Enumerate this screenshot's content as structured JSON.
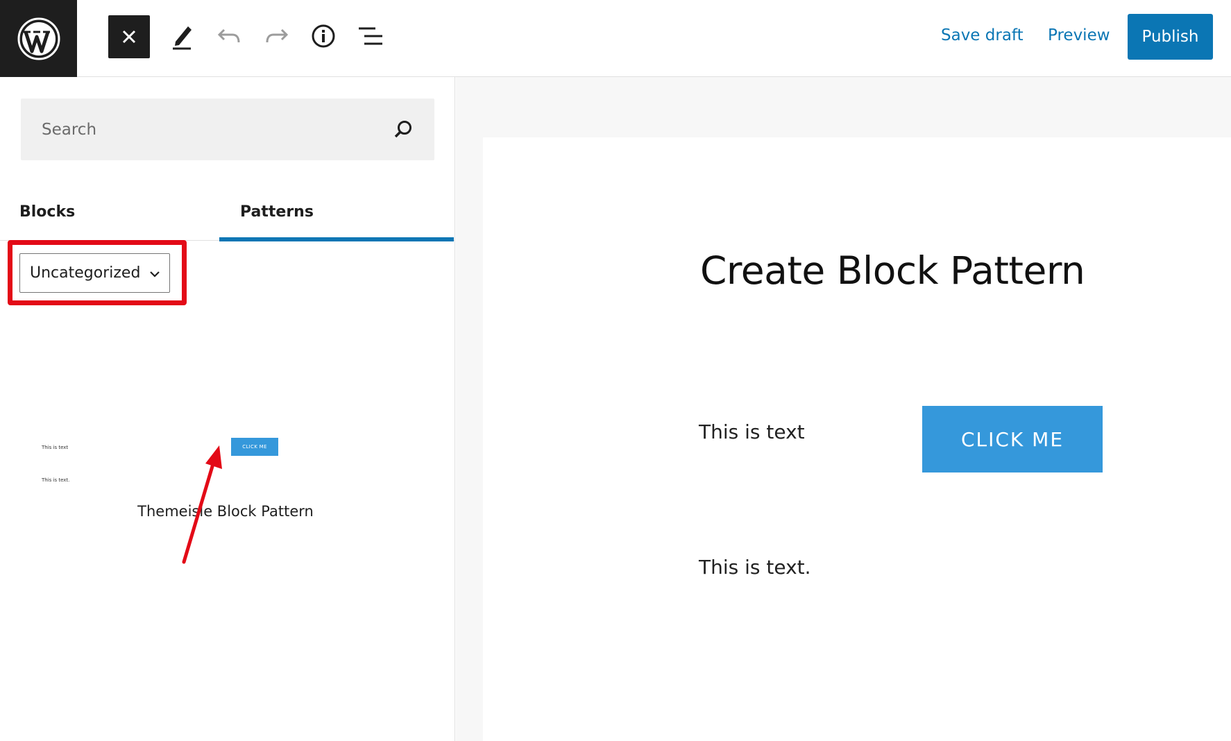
{
  "toolbar": {
    "logo_icon": "wordpress-logo-icon",
    "close_icon": "close-icon",
    "edit_icon": "pencil-icon",
    "undo_icon": "undo-icon",
    "redo_icon": "redo-icon",
    "info_icon": "info-icon",
    "list_view_icon": "list-view-icon",
    "save_draft_label": "Save draft",
    "preview_label": "Preview",
    "publish_label": "Publish",
    "accent_color": "#0b76b4"
  },
  "inserter": {
    "search": {
      "placeholder": "Search",
      "value": "",
      "icon": "search-icon"
    },
    "tabs": [
      {
        "label": "Blocks",
        "active": false
      },
      {
        "label": "Patterns",
        "active": true
      }
    ],
    "category_select": {
      "selected": "Uncategorized",
      "icon": "chevron-down-icon"
    },
    "highlight_color": "#e30a17",
    "patterns": [
      {
        "title": "Themeisle Block Pattern",
        "preview": {
          "text_1": "This is text",
          "button": "CLICK ME",
          "text_2": "This is text."
        }
      }
    ],
    "annotation": "red-arrow-pointing-to-pattern"
  },
  "editor": {
    "title": "Create Block Pattern",
    "paragraph_1": "This is text",
    "button_label": "CLICK ME",
    "button_color": "#3598db",
    "paragraph_2": "This is text."
  }
}
